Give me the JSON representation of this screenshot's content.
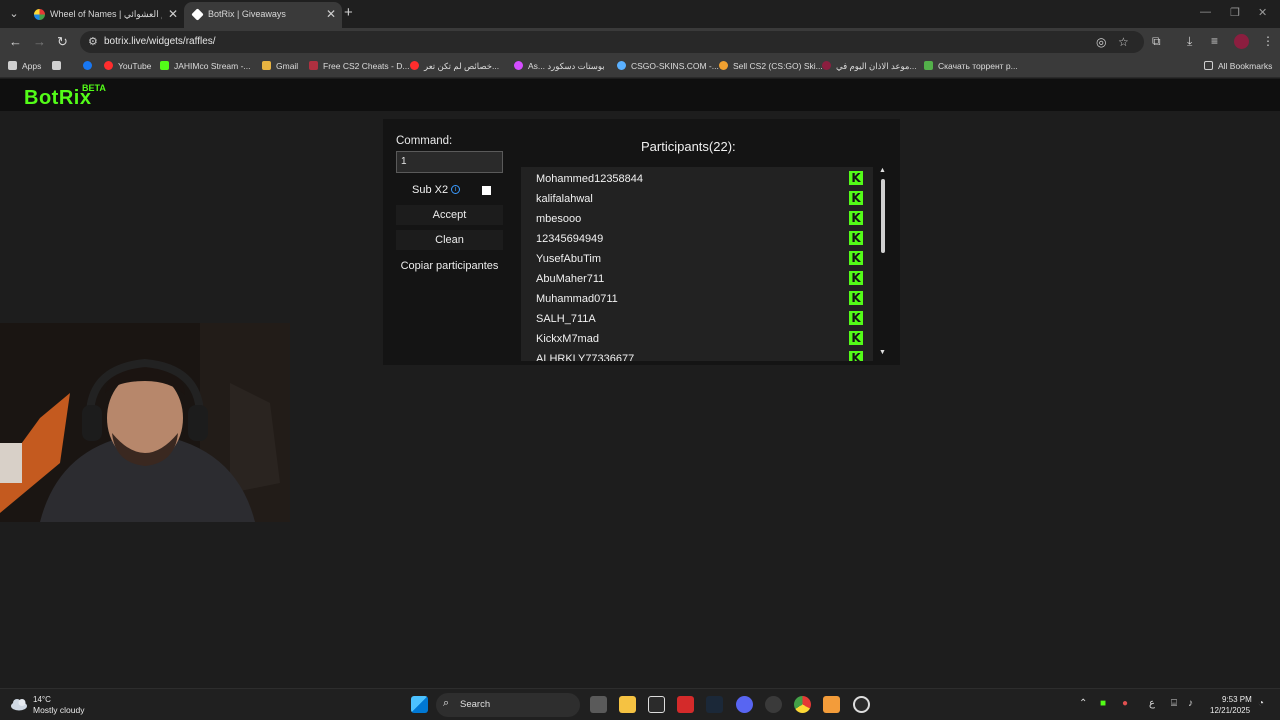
{
  "browser": {
    "tabs": [
      {
        "title": "Wheel of Names | اسم العشوائي",
        "active": false
      },
      {
        "title": "BotRix | Giveaways",
        "active": true
      }
    ],
    "url": "botrix.live/widgets/raffles/",
    "bookmarks": [
      {
        "label": "Apps",
        "color": "#e8e8e8"
      },
      {
        "label": "",
        "color": "#5f87ff"
      },
      {
        "label": "YouTube",
        "color": "#ff2d2d"
      },
      {
        "label": "JAHIMco Stream -...",
        "color": "#53fc18"
      },
      {
        "label": "Gmail",
        "color": "#e8b341"
      },
      {
        "label": "Free CS2 Cheats - D...",
        "color": "#b03040"
      },
      {
        "label": "خصائص لم تكن تعر...",
        "color": "#ff2d2d"
      },
      {
        "label": "As... بوستات دسكورد",
        "color": "#d44dff"
      },
      {
        "label": "CSGO-SKINS.COM -...",
        "color": "#5ab0ff"
      },
      {
        "label": "Sell CS2 (CS:GO) Ski...",
        "color": "#f0a030"
      },
      {
        "label": "موعد الاذان اليوم في...",
        "color": "#8b1e3f"
      },
      {
        "label": "Скачать торрент р...",
        "color": "#53b04a"
      },
      {
        "label": "All Bookmarks",
        "color": "#cfcfcf"
      }
    ]
  },
  "site": {
    "logo": "BotRix",
    "badge": "BETA"
  },
  "raffle": {
    "command_label": "Command:",
    "command_value": "1",
    "sub_label": "Sub X2",
    "sub_checked": false,
    "accept_label": "Accept",
    "clean_label": "Clean",
    "copy_label": "Copiar participantes",
    "participants_title": "Participants(22):",
    "participants": [
      "Mohammed12358844",
      "kalifalahwal",
      "mbesooo",
      "12345694949",
      "YusefAbuTim",
      "AbuMaher711",
      "Muhammad0711",
      "SALH_711A",
      "KickxM7mad",
      "ALHRKLY77336677"
    ]
  },
  "taskbar": {
    "weather_temp": "14°C",
    "weather_desc": "Mostly cloudy",
    "search_label": "Search",
    "lang": "ع",
    "time": "9:53 PM",
    "date": "12/21/2025"
  },
  "colors": {
    "kick_green": "#53fc18",
    "panel_bg": "#141414",
    "page_bg": "#1d1d1d"
  }
}
